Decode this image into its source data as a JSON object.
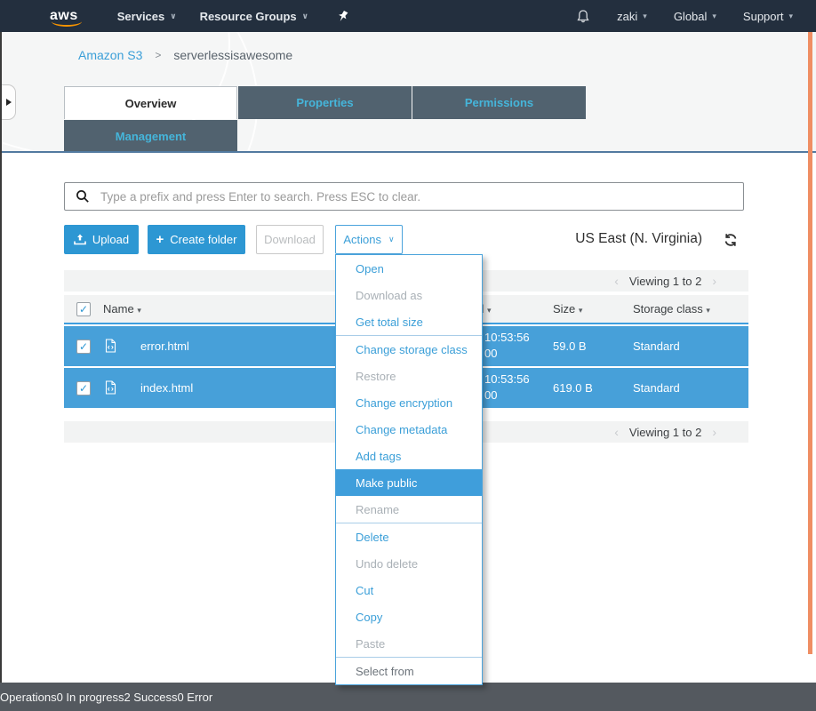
{
  "colors": {
    "nav_bg": "#232f3e",
    "accent_blue": "#3b9fd8",
    "row_blue": "#47a0d9",
    "highlight_blue": "#3f9edb",
    "tab_bg": "#51626f",
    "tab_text": "#45b5da",
    "footer_bg": "#54595f",
    "scrollbar_orange": "#ef8e63",
    "logo_orange": "#f79400"
  },
  "topnav": {
    "logo": "aws",
    "services_label": "Services",
    "services_caret": "∨",
    "resource_groups_label": "Resource Groups",
    "resource_groups_caret": "∨",
    "user_label": "zaki",
    "user_caret": "▾",
    "region_label": "Global",
    "region_caret": "▾",
    "support_label": "Support",
    "support_caret": "▾"
  },
  "breadcrumb": {
    "link": "Amazon S3",
    "separator": ">",
    "current": "serverlessisawesome"
  },
  "tabs": [
    {
      "label": "Overview",
      "active": true
    },
    {
      "label": "Properties",
      "active": false
    },
    {
      "label": "Permissions",
      "active": false
    },
    {
      "label": "Management",
      "active": false
    }
  ],
  "search": {
    "placeholder": "Type a prefix and press Enter to search. Press ESC to clear."
  },
  "toolbar": {
    "upload_label": "Upload",
    "create_folder_label": "Create folder",
    "create_folder_plus": "+",
    "download_label": "Download",
    "actions_label": "Actions",
    "actions_caret": "∨",
    "region": "US East (N. Virginia)"
  },
  "table": {
    "viewing_top": "Viewing 1 to 2",
    "viewing_bottom": "Viewing 1 to 2",
    "prev_chevron": "‹",
    "next_chevron": "›",
    "columns": [
      {
        "label": "Name",
        "sort": "▾"
      },
      {
        "label": "Last modified",
        "sort": "▾"
      },
      {
        "label": "Size",
        "sort": "▾"
      },
      {
        "label": "Storage class",
        "sort": "▾"
      }
    ],
    "checkbox_tick": "✓",
    "rows": [
      {
        "name": "error.html",
        "modified_line1": "10:53:56",
        "modified_line2": "00",
        "size": "59.0 B",
        "storage_class": "Standard",
        "selected": true
      },
      {
        "name": "index.html",
        "modified_line1": "10:53:56",
        "modified_line2": "00",
        "size": "619.0 B",
        "storage_class": "Standard",
        "selected": true
      }
    ]
  },
  "menu": {
    "items": [
      {
        "label": "Open",
        "state": "enabled"
      },
      {
        "label": "Download as",
        "state": "disabled"
      },
      {
        "label": "Get total size",
        "state": "enabled"
      },
      {
        "label": "Change storage class",
        "state": "enabled"
      },
      {
        "label": "Restore",
        "state": "disabled"
      },
      {
        "label": "Change encryption",
        "state": "enabled"
      },
      {
        "label": "Change metadata",
        "state": "enabled"
      },
      {
        "label": "Add tags",
        "state": "enabled"
      },
      {
        "label": "Make public",
        "state": "highlighted"
      },
      {
        "label": "Rename",
        "state": "disabled"
      },
      {
        "label": "Delete",
        "state": "enabled"
      },
      {
        "label": "Undo delete",
        "state": "disabled"
      },
      {
        "label": "Cut",
        "state": "enabled"
      },
      {
        "label": "Copy",
        "state": "enabled"
      },
      {
        "label": "Paste",
        "state": "disabled"
      },
      {
        "label": "Select from",
        "state": "muted"
      }
    ]
  },
  "footer": {
    "operations": "Operations",
    "in_progress": "0 In progress",
    "success": "2 Success",
    "error": "0 Error"
  }
}
